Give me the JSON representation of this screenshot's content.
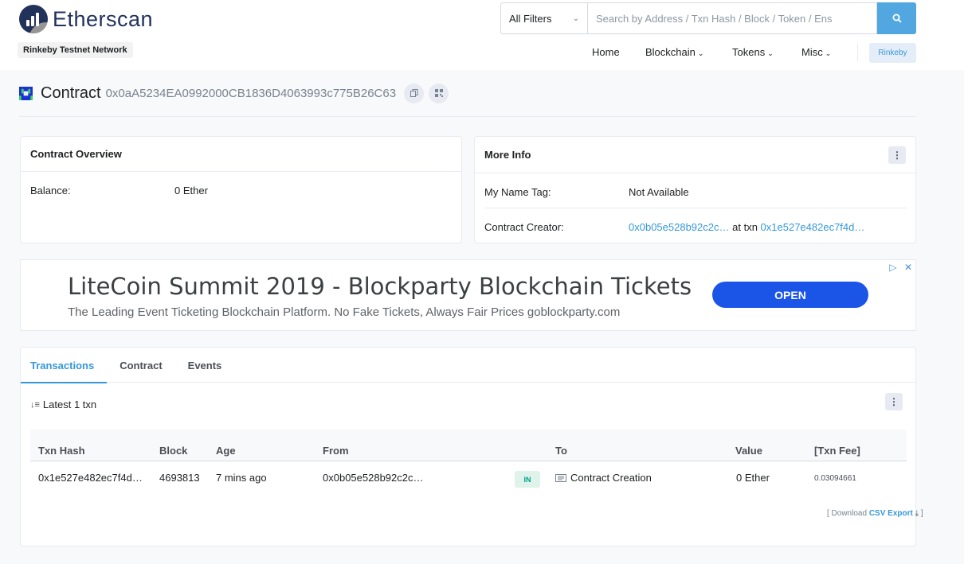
{
  "header": {
    "logo_text": "Etherscan",
    "network_badge": "Rinkeby Testnet Network",
    "filter_label": "All Filters",
    "search_placeholder": "Search by Address / Txn Hash / Block / Token / Ens",
    "nav": [
      {
        "label": "Home"
      },
      {
        "label": "Blockchain"
      },
      {
        "label": "Tokens"
      },
      {
        "label": "Misc"
      }
    ],
    "network_button": "Rinkeby"
  },
  "page": {
    "title_label": "Contract",
    "address": "0x0aA5234EA0992000CB1836D4063993c775B26C63"
  },
  "overview": {
    "title": "Contract Overview",
    "balance_label": "Balance:",
    "balance_value": "0 Ether"
  },
  "more_info": {
    "title": "More Info",
    "name_tag_label": "My Name Tag:",
    "name_tag_value": "Not Available",
    "creator_label": "Contract Creator:",
    "creator_address": "0x0b05e528b92c2c…",
    "creator_at_txn": "at txn",
    "creator_txn": "0x1e527e482ec7f4d…"
  },
  "ad": {
    "title": "LiteCoin Summit 2019 - Blockparty Blockchain Tickets",
    "subtitle": "The Leading Event Ticketing Blockchain Platform. No Fake Tickets, Always Fair Prices goblockparty.com",
    "button": "OPEN"
  },
  "txns": {
    "tabs": [
      "Transactions",
      "Contract",
      "Events"
    ],
    "summary": "Latest 1 txn",
    "columns": [
      "Txn Hash",
      "Block",
      "Age",
      "From",
      "To",
      "Value",
      "[Txn Fee]"
    ],
    "rows": [
      {
        "hash": "0x1e527e482ec7f4d…",
        "block": "4693813",
        "age": "7 mins ago",
        "from": "0x0b05e528b92c2c…",
        "direction": "IN",
        "to": "Contract Creation",
        "value": "0 Ether",
        "fee": "0.03094661"
      }
    ],
    "download_prefix": "[ Download",
    "csv_export": "CSV Export",
    "download_suffix": "]"
  }
}
